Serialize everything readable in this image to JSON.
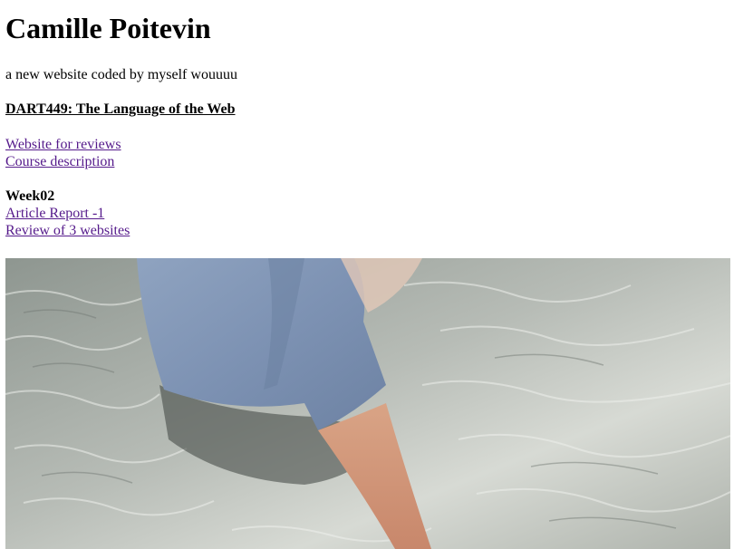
{
  "header": {
    "title": "Camille Poitevin",
    "subtitle": "a new website coded by myself wouuuu"
  },
  "course": {
    "heading": "DART449: The Language of the Web",
    "links": [
      {
        "label": "Website for reviews"
      },
      {
        "label": "Course description"
      }
    ]
  },
  "week": {
    "heading": "Week02",
    "links": [
      {
        "label": "Article Report -1"
      },
      {
        "label": "Review of 3 websites"
      }
    ]
  },
  "colors": {
    "link": "#551a8b",
    "text": "#000000",
    "background": "#ffffff"
  }
}
